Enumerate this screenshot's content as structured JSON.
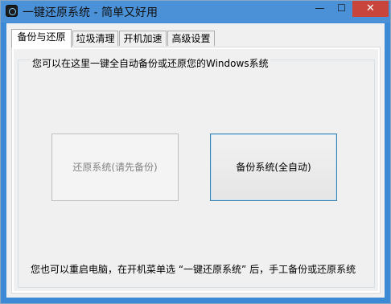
{
  "window": {
    "title": "一键还原系统 - 简单又好用",
    "icon": "app-icon",
    "controls": {
      "minimize": "—",
      "maximize": "☐",
      "close": "✕"
    }
  },
  "tabs": [
    {
      "label": "备份与还原",
      "active": true
    },
    {
      "label": "垃圾清理",
      "active": false
    },
    {
      "label": "开机加速",
      "active": false
    },
    {
      "label": "高级设置",
      "active": false
    }
  ],
  "backup_panel": {
    "group_label": "您可以在这里一键全自动备份或还原您的Windows系统",
    "restore_button": {
      "label": "还原系统(请先备份)",
      "enabled": false
    },
    "backup_button": {
      "label": "备份系统(全自动)",
      "enabled": true
    },
    "footer_note": "您也可以重启电脑，在开机菜单选 “一键还原系统” 后，手工备份或还原系统"
  },
  "colors": {
    "titlebar": "#4a91d8",
    "close_button": "#c7453a",
    "focus_border": "#3c7fb1"
  }
}
